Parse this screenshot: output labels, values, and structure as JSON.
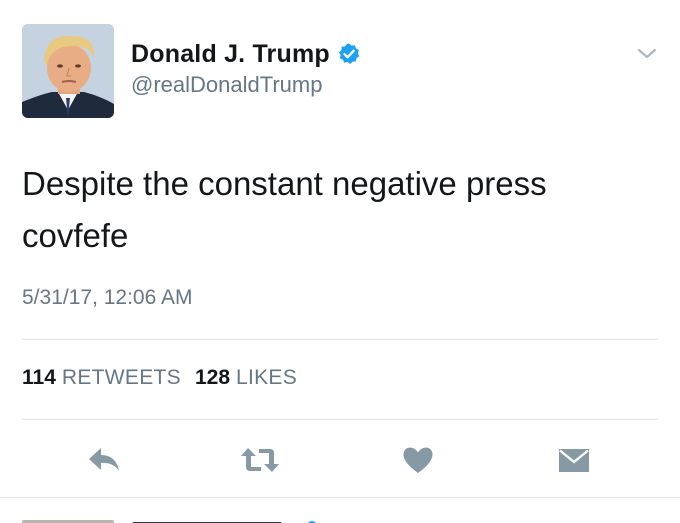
{
  "tweet": {
    "author": {
      "display_name": "Donald J. Trump",
      "handle": "@realDonaldTrump",
      "verified": true
    },
    "text_lines": [
      "Despite the constant negative press",
      "covfefe"
    ],
    "timestamp": "5/31/17, 12:06 AM",
    "stats": {
      "retweets_count": "114",
      "retweets_label": "RETWEETS",
      "likes_count": "128",
      "likes_label": "LIKES"
    },
    "actions": [
      {
        "icon": "reply-icon"
      },
      {
        "icon": "retweet-icon"
      },
      {
        "icon": "heart-icon"
      },
      {
        "icon": "envelope-icon"
      }
    ]
  },
  "colors": {
    "verified_blue": "#1da1f2",
    "icon_gray": "#8899a6",
    "text_primary": "#14171a",
    "text_secondary": "#657786"
  }
}
